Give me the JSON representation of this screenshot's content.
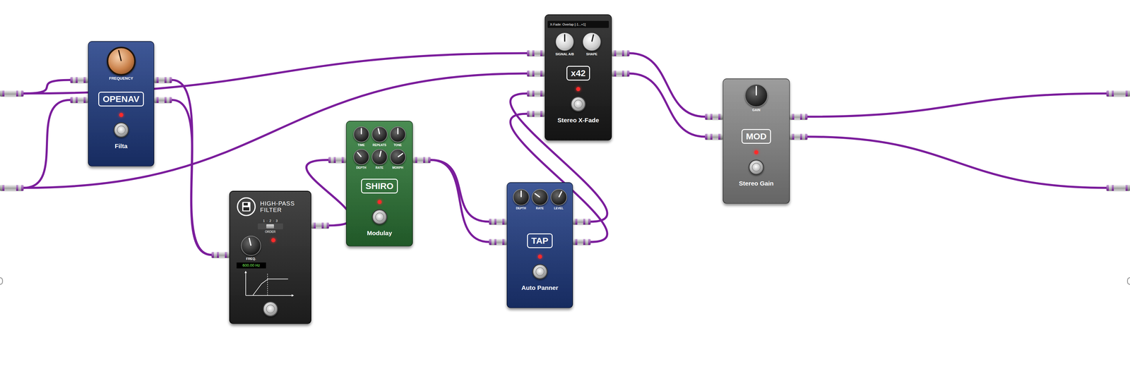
{
  "system": {
    "inputs": 2,
    "outputs": 2
  },
  "pedals": [
    {
      "kind": "standard",
      "name": "Filta",
      "badge": "OPENAV",
      "color": "#1f3c85",
      "led_on": true,
      "inputs": 2,
      "outputs": 2,
      "knobs": [
        {
          "label": "FREQUENCY",
          "level": 0.45,
          "kind": "copper"
        }
      ]
    },
    {
      "kind": "display",
      "title_lines": [
        "HIGH-PASS",
        "FILTER"
      ],
      "color": "#262626",
      "led_on": true,
      "inputs": 1,
      "outputs": 1,
      "order": {
        "label": "ORDER",
        "separator": "·",
        "options": [
          {
            "label": "1",
            "selected": false
          },
          {
            "label": "2",
            "selected": true
          },
          {
            "label": "3",
            "selected": false
          }
        ]
      },
      "knobs": [
        {
          "label": "FREQ.",
          "level": 0.45,
          "kind": "black"
        }
      ],
      "readout": "600.00 Hz"
    },
    {
      "kind": "standard",
      "name": "Modulay",
      "badge": "SHIRO",
      "color": "#2d7a37",
      "led_on": true,
      "inputs": 1,
      "outputs": 1,
      "knobs": [
        {
          "label": "TIME",
          "level": 0.5,
          "kind": "black"
        },
        {
          "label": "REPEATS",
          "level": 0.45,
          "kind": "black"
        },
        {
          "label": "TONE",
          "level": 0.5,
          "kind": "black"
        },
        {
          "label": "DEPTH",
          "level": 0.35,
          "kind": "black"
        },
        {
          "label": "RATE",
          "level": 0.55,
          "kind": "black"
        },
        {
          "label": "MORPH",
          "level": 0.7,
          "kind": "black"
        }
      ]
    },
    {
      "kind": "standard",
      "name": "Auto Panner",
      "badge": "TAP",
      "color": "#1f3c85",
      "led_on": true,
      "inputs": 2,
      "outputs": 2,
      "knobs": [
        {
          "label": "DEPTH",
          "level": 0.5,
          "kind": "black"
        },
        {
          "label": "RATE",
          "level": 0.3,
          "kind": "black"
        },
        {
          "label": "LEVEL",
          "level": 0.6,
          "kind": "black"
        }
      ]
    },
    {
      "kind": "standard",
      "name": "Stereo X-Fade",
      "badge": "x42",
      "color": "#1b1b1b",
      "tooltip": "X-Fade: Overlap [-1...+1]",
      "led_on": true,
      "inputs": 4,
      "outputs": 2,
      "knobs": [
        {
          "label": "SIGNAL A/B",
          "level": 0.5,
          "kind": "silver"
        },
        {
          "label": "SHAPE",
          "level": 0.55,
          "kind": "silver"
        }
      ]
    },
    {
      "kind": "standard",
      "name": "Stereo Gain",
      "badge": "MOD",
      "color": "#8c8c8c",
      "led_on": true,
      "inputs": 2,
      "outputs": 2,
      "knobs": [
        {
          "label": "GAIN",
          "level": 0.5,
          "kind": "black"
        }
      ]
    }
  ],
  "cables": [
    {
      "from": [
        "system",
        0
      ],
      "to": [
        0,
        0
      ]
    },
    {
      "from": [
        "system",
        1
      ],
      "to": [
        0,
        1
      ]
    },
    {
      "from": [
        "system",
        0
      ],
      "to": [
        4,
        0
      ]
    },
    {
      "from": [
        "system",
        1
      ],
      "to": [
        4,
        1
      ]
    },
    {
      "from": [
        0,
        0
      ],
      "to": [
        1,
        0
      ]
    },
    {
      "from": [
        0,
        1
      ],
      "to": [
        1,
        0
      ]
    },
    {
      "from": [
        1,
        0
      ],
      "to": [
        2,
        0
      ]
    },
    {
      "from": [
        2,
        0
      ],
      "to": [
        3,
        0
      ]
    },
    {
      "from": [
        2,
        0
      ],
      "to": [
        3,
        1
      ]
    },
    {
      "from": [
        3,
        0
      ],
      "to": [
        4,
        2
      ]
    },
    {
      "from": [
        3,
        1
      ],
      "to": [
        4,
        3
      ]
    },
    {
      "from": [
        4,
        0
      ],
      "to": [
        5,
        0
      ]
    },
    {
      "from": [
        4,
        1
      ],
      "to": [
        5,
        1
      ]
    },
    {
      "from": [
        5,
        0
      ],
      "to": [
        "system",
        0
      ]
    },
    {
      "from": [
        5,
        1
      ],
      "to": [
        "system",
        1
      ]
    }
  ]
}
